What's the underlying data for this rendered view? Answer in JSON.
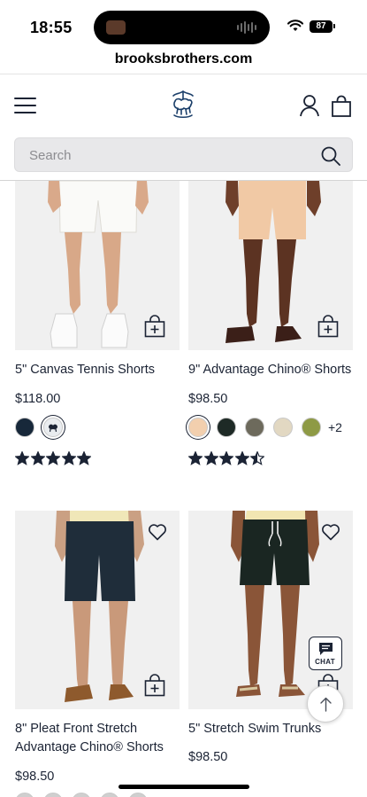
{
  "status_bar": {
    "time": "18:55",
    "battery": "87",
    "icons": [
      "music-app-icon",
      "audio-waveform-icon",
      "wifi-icon",
      "battery-icon"
    ]
  },
  "browser": {
    "url": "brooksbrothers.com"
  },
  "header": {
    "icons": [
      "menu-icon",
      "golden-fleece-logo-icon",
      "account-icon",
      "shopping-bag-icon"
    ]
  },
  "search": {
    "placeholder": "Search",
    "icon": "search-icon"
  },
  "colors": {
    "text": "#1b2334",
    "accent": "#1b2334",
    "image_bg": "#efefef",
    "search_bg": "#e8e8ea"
  },
  "products": [
    {
      "title": "5\" Canvas Tennis Shorts",
      "price": "$118.00",
      "swatches": [
        "#17283a",
        "#e9ecef"
      ],
      "extra_colors": "",
      "rating": 5
    },
    {
      "title": "9\" Advantage Chino® Shorts",
      "price": "$98.50",
      "swatches": [
        "#f2cfae",
        "#1e2a26",
        "#6d6a5c",
        "#e2d8c2",
        "#8e9a45"
      ],
      "extra_colors": "+2",
      "rating": 4.5
    },
    {
      "title": "8\" Pleat Front Stretch Advantage Chino® Shorts",
      "price": "$98.50",
      "swatches": [
        "#cfcfcf",
        "#cfcfcf",
        "#cfcfcf",
        "#cfcfcf",
        "#cfcfcf"
      ],
      "extra_colors": "",
      "rating": 0
    },
    {
      "title": "5\" Stretch Swim Trunks",
      "price": "$98.50",
      "swatches": [],
      "extra_colors": "",
      "rating": 0
    }
  ],
  "floating": {
    "chat_label": "CHAT",
    "chat_icon": "chat-bubble-icon",
    "top_icon": "arrow-up-icon"
  }
}
